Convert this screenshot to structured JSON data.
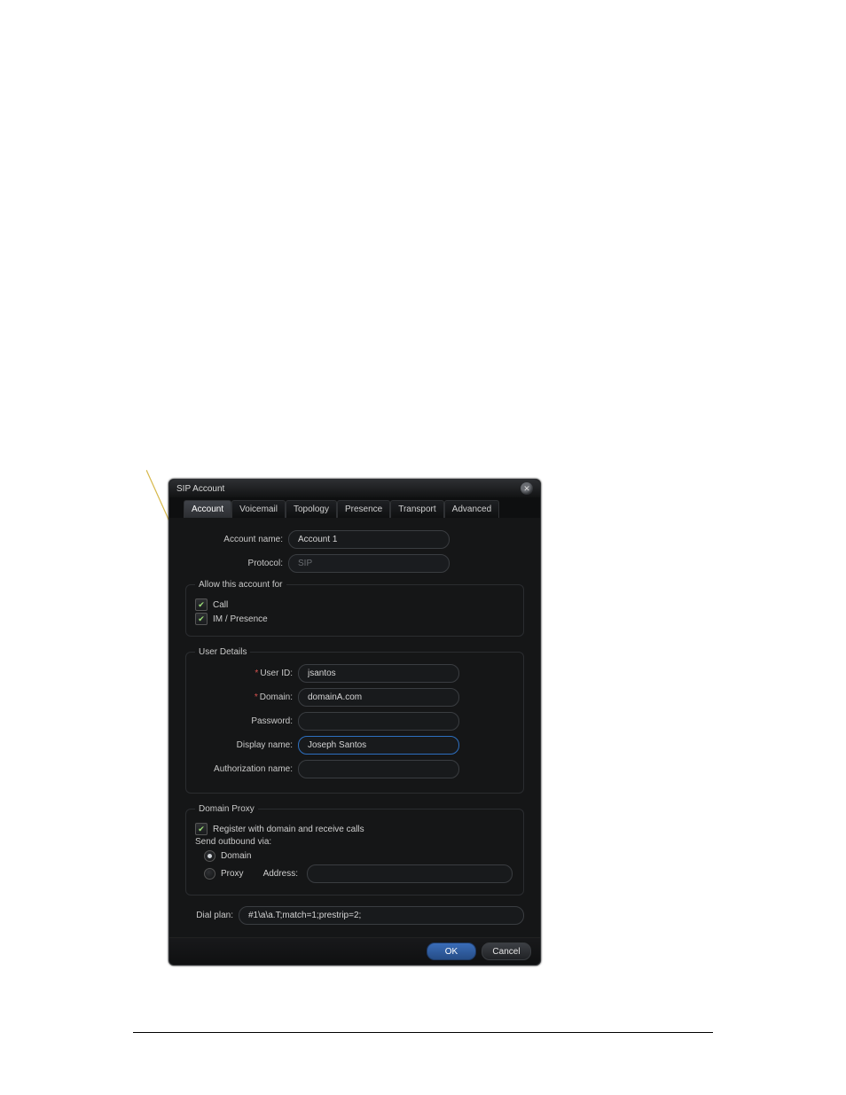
{
  "dialog": {
    "title": "SIP Account",
    "tabs": [
      "Account",
      "Voicemail",
      "Topology",
      "Presence",
      "Transport",
      "Advanced"
    ],
    "account_name_label": "Account name:",
    "account_name_value": "Account 1",
    "protocol_label": "Protocol:",
    "protocol_value": "SIP",
    "allow_legend": "Allow this account for",
    "allow_call": "Call",
    "allow_im": "IM / Presence",
    "user_details_legend": "User Details",
    "userid_label": "User ID:",
    "userid_value": "jsantos",
    "domain_label": "Domain:",
    "domain_value": "domainA.com",
    "password_label": "Password:",
    "password_value": "",
    "display_label": "Display name:",
    "display_value": "Joseph Santos",
    "auth_label": "Authorization name:",
    "auth_value": "",
    "domain_proxy_legend": "Domain Proxy",
    "register_label": "Register with domain and receive calls",
    "send_outbound_label": "Send outbound via:",
    "radio_domain": "Domain",
    "radio_proxy": "Proxy",
    "proxy_address_label": "Address:",
    "proxy_address_value": "",
    "dialplan_label": "Dial plan:",
    "dialplan_value": "#1\\a\\a.T;match=1;prestrip=2;",
    "ok_label": "OK",
    "cancel_label": "Cancel"
  }
}
